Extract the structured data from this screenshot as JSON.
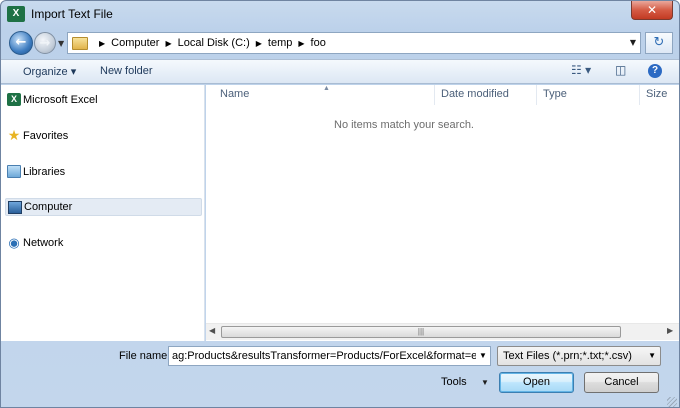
{
  "window": {
    "title": "Import Text File",
    "app_icon_text": "X",
    "close_label": "✕"
  },
  "nav": {
    "back_glyph": "←",
    "forward_glyph": "→",
    "breadcrumbs": [
      "Computer",
      "Local Disk (C:)",
      "temp",
      "foo"
    ],
    "refresh_glyph": "↻"
  },
  "toolbar": {
    "organize_label": "Organize ▾",
    "new_folder_label": "New folder",
    "help_glyph": "?"
  },
  "sidebar": {
    "items": [
      {
        "label": "Microsoft Excel",
        "icon": "excel-icon",
        "selected": false
      },
      {
        "label": "Favorites",
        "icon": "star-icon",
        "selected": false
      },
      {
        "label": "Libraries",
        "icon": "library-icon",
        "selected": false
      },
      {
        "label": "Computer",
        "icon": "computer-icon",
        "selected": true
      },
      {
        "label": "Network",
        "icon": "network-icon",
        "selected": false
      }
    ]
  },
  "list": {
    "columns": [
      "Name",
      "Date modified",
      "Type",
      "Size"
    ],
    "empty_message": "No items match your search."
  },
  "footer": {
    "file_name_label": "File name:",
    "file_name_value": "ag:Products&resultsTransformer=Products/ForExcel&format=excel",
    "file_type_value": "Text Files (*.prn;*.txt;*.csv)",
    "tools_label": "Tools",
    "open_label": "Open",
    "cancel_label": "Cancel"
  },
  "colors": {
    "accent": "#2c6ac3",
    "excel_green": "#1e7145",
    "close_red": "#c23a22"
  }
}
